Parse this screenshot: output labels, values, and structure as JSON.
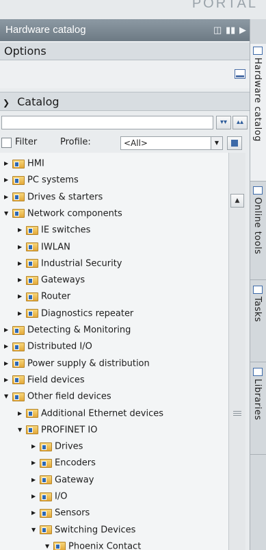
{
  "portal_label": "PORTAL",
  "header": {
    "title": "Hardware catalog"
  },
  "options": {
    "label": "Options"
  },
  "catalog": {
    "label": "Catalog",
    "search_value": "",
    "filter_label": "Filter",
    "profile_label": "Profile:",
    "profile_value": "<All>"
  },
  "tree": [
    {
      "label": "HMI",
      "level": 0,
      "expanded": false
    },
    {
      "label": "PC systems",
      "level": 0,
      "expanded": false
    },
    {
      "label": "Drives & starters",
      "level": 0,
      "expanded": false
    },
    {
      "label": "Network components",
      "level": 0,
      "expanded": true
    },
    {
      "label": "IE switches",
      "level": 1,
      "expanded": false
    },
    {
      "label": "IWLAN",
      "level": 1,
      "expanded": false
    },
    {
      "label": "Industrial Security",
      "level": 1,
      "expanded": false
    },
    {
      "label": "Gateways",
      "level": 1,
      "expanded": false
    },
    {
      "label": "Router",
      "level": 1,
      "expanded": false
    },
    {
      "label": "Diagnostics repeater",
      "level": 1,
      "expanded": false
    },
    {
      "label": "Detecting & Monitoring",
      "level": 0,
      "expanded": false
    },
    {
      "label": "Distributed I/O",
      "level": 0,
      "expanded": false
    },
    {
      "label": "Power supply & distribution",
      "level": 0,
      "expanded": false
    },
    {
      "label": "Field devices",
      "level": 0,
      "expanded": false
    },
    {
      "label": "Other field devices",
      "level": 0,
      "expanded": true
    },
    {
      "label": "Additional Ethernet devices",
      "level": 1,
      "expanded": false
    },
    {
      "label": "PROFINET IO",
      "level": 1,
      "expanded": true
    },
    {
      "label": "Drives",
      "level": 2,
      "expanded": false
    },
    {
      "label": "Encoders",
      "level": 2,
      "expanded": false
    },
    {
      "label": "Gateway",
      "level": 2,
      "expanded": false
    },
    {
      "label": "I/O",
      "level": 2,
      "expanded": false
    },
    {
      "label": "Sensors",
      "level": 2,
      "expanded": false
    },
    {
      "label": "Switching Devices",
      "level": 2,
      "expanded": true
    },
    {
      "label": "Phoenix Contact",
      "level": 3,
      "expanded": true
    }
  ],
  "side_tabs": [
    {
      "label": "Hardware catalog",
      "icon": "catalog-icon",
      "active": true
    },
    {
      "label": "Online tools",
      "icon": "online-tools-icon",
      "active": false
    },
    {
      "label": "Tasks",
      "icon": "tasks-icon",
      "active": false
    },
    {
      "label": "Libraries",
      "icon": "libraries-icon",
      "active": false
    }
  ]
}
